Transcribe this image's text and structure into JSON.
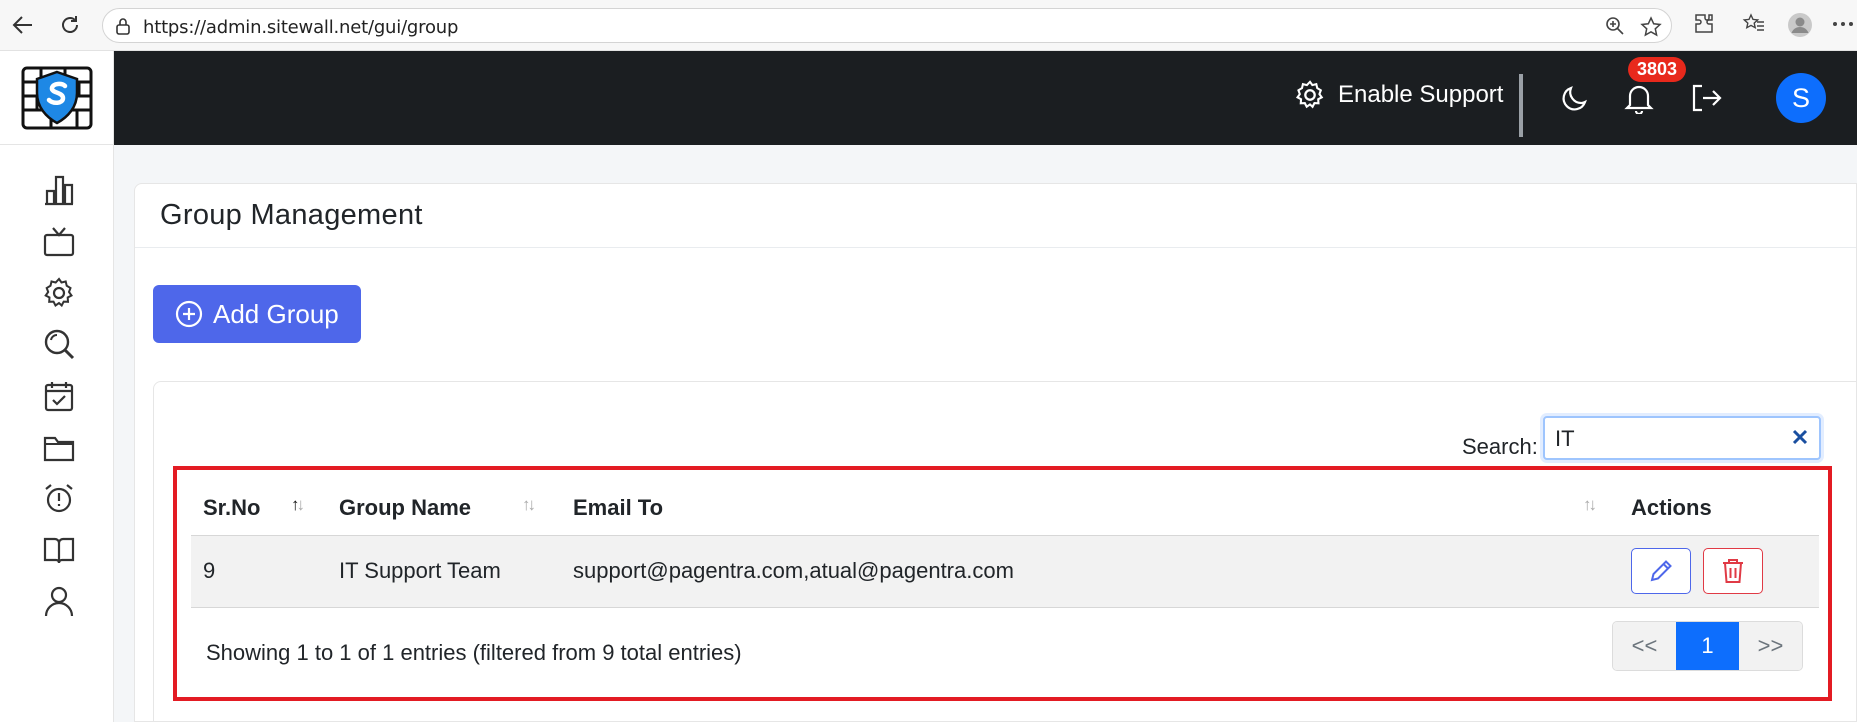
{
  "browser": {
    "url": "https://admin.sitewall.net/gui/group"
  },
  "header": {
    "enable_support_label": "Enable Support",
    "notification_count": "3803",
    "avatar_initial": "S"
  },
  "page": {
    "title": "Group Management",
    "add_button_label": "Add Group"
  },
  "search": {
    "label": "Search:",
    "value": "IT"
  },
  "table": {
    "columns": [
      "Sr.No",
      "Group Name",
      "Email To",
      "Actions"
    ],
    "rows": [
      {
        "sr_no": "9",
        "group_name": "IT Support Team",
        "email_to": "support@pagentra.com,atual@pagentra.com"
      }
    ]
  },
  "footer": {
    "info": "Showing 1 to 1 of 1 entries (filtered from 9 total entries)",
    "pager_prev": "<<",
    "pager_current": "1",
    "pager_next": ">>"
  },
  "colors": {
    "accent": "#4e67ea",
    "topbar": "#1b1e21",
    "badge": "#e8291c",
    "highlight": "#e31b23",
    "primary": "#0d6efd"
  },
  "icons": {
    "sidebar": [
      "chart-bar-icon",
      "tv-icon",
      "settings-icon",
      "search-scan-icon",
      "calendar-check-icon",
      "folder-icon",
      "alarm-clock-icon",
      "book-icon",
      "user-icon"
    ]
  }
}
